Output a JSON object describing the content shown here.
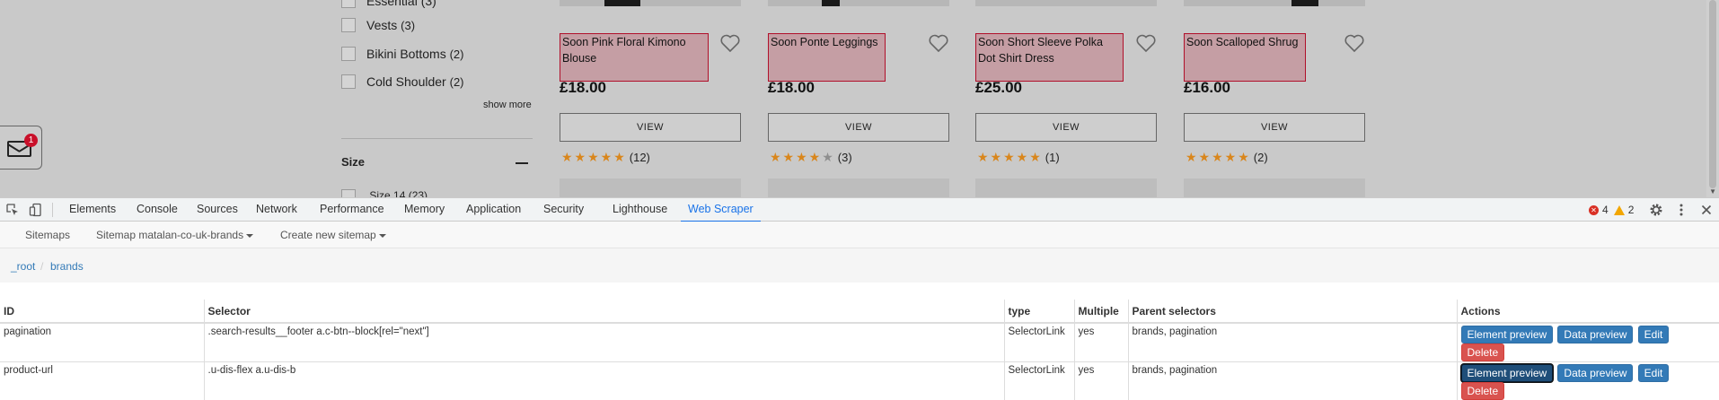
{
  "page": {
    "filters": [
      {
        "label": "Essential (3)"
      },
      {
        "label": "Vests",
        "count": "(3)"
      },
      {
        "label": "Bikini Bottoms",
        "count": "(2)"
      },
      {
        "label": "Cold Shoulder",
        "count": "(2)"
      }
    ],
    "show_more": "show more",
    "size_heading": "Size",
    "size_sub": "Size 14 (23)",
    "mail_badge": "1",
    "products": [
      {
        "title": "Soon Pink Floral Kimono Blouse",
        "price": "£18.00",
        "view": "VIEW",
        "stars": 5,
        "reviews": "(12)"
      },
      {
        "title": "Soon Ponte Leggings",
        "price": "£18.00",
        "view": "VIEW",
        "stars": 4,
        "reviews": "(3)"
      },
      {
        "title": "Soon Short Sleeve Polka Dot Shirt Dress",
        "price": "£25.00",
        "view": "VIEW",
        "stars": 5,
        "reviews": "(1)"
      },
      {
        "title": "Soon Scalloped Shrug",
        "price": "£16.00",
        "view": "VIEW",
        "stars": 5,
        "reviews": "(2)"
      }
    ],
    "accent_price_box": "#c59ea4",
    "star_color": "#d9861c"
  },
  "devtools": {
    "tabs": [
      "Elements",
      "Console",
      "Sources",
      "Network",
      "Performance",
      "Memory",
      "Application",
      "Security",
      "Lighthouse",
      "Web Scraper"
    ],
    "active_tab": "Web Scraper",
    "errors": "4",
    "warnings": "2",
    "icons": [
      "inspect-icon",
      "device-toggle-icon",
      "settings-icon",
      "more-vertical-icon",
      "close-icon"
    ],
    "accent": "#1a73e8"
  },
  "scraper": {
    "nav": {
      "sitemaps": "Sitemaps",
      "sitemap": "Sitemap matalan-co-uk-brands",
      "create": "Create new sitemap"
    },
    "breadcrumb": [
      "_root",
      "brands"
    ],
    "table": {
      "headers": [
        "ID",
        "Selector",
        "type",
        "Multiple",
        "Parent selectors",
        "Actions"
      ],
      "rows": [
        {
          "id": "pagination",
          "selector": ".search-results__footer a.c-btn--block[rel=\"next\"]",
          "type": "SelectorLink",
          "multiple": "yes",
          "parents": "brands, pagination"
        },
        {
          "id": "product-url",
          "selector": ".u-dis-flex a.u-dis-b",
          "type": "SelectorLink",
          "multiple": "yes",
          "parents": "brands, pagination"
        }
      ],
      "actions": {
        "element_preview": "Element preview",
        "data_preview": "Data preview",
        "edit": "Edit",
        "delete": "Delete"
      }
    }
  }
}
